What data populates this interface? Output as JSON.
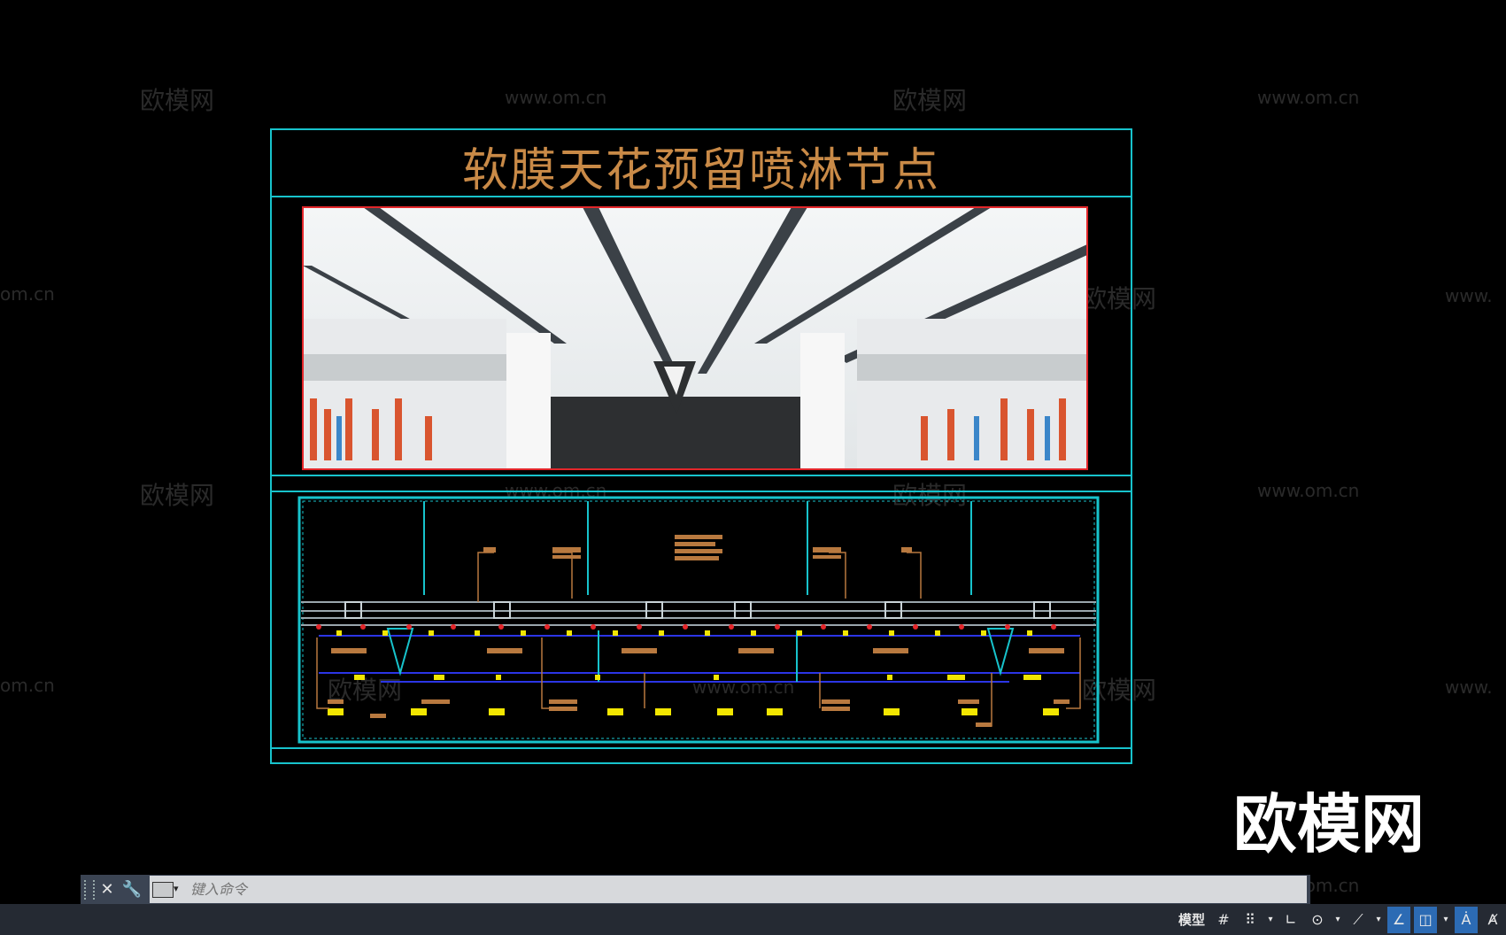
{
  "drawing": {
    "title": "软膜天花预留喷淋节点"
  },
  "watermarks": {
    "logo_text": "欧模网",
    "url_text": "www.om.cn",
    "partial_url": "om.cn",
    "partial_www": "www."
  },
  "brand_logo": "欧模网",
  "command_line": {
    "placeholder": "键入命令",
    "close_icon": "close-icon",
    "customize_icon": "wrench-icon",
    "prompt_icon": "command-prompt-icon"
  },
  "status_bar": {
    "model_label": "模型",
    "icons": [
      "grid-icon",
      "snap-icon",
      "ortho-icon",
      "polar-icon",
      "osnap-track-icon",
      "lineweight-icon",
      "selection-cycle-icon",
      "annotation-icon",
      "workspace-icon"
    ]
  },
  "colors": {
    "frame": "#17c3cc",
    "title": "#c98a47",
    "photo_border": "#e3262a"
  }
}
